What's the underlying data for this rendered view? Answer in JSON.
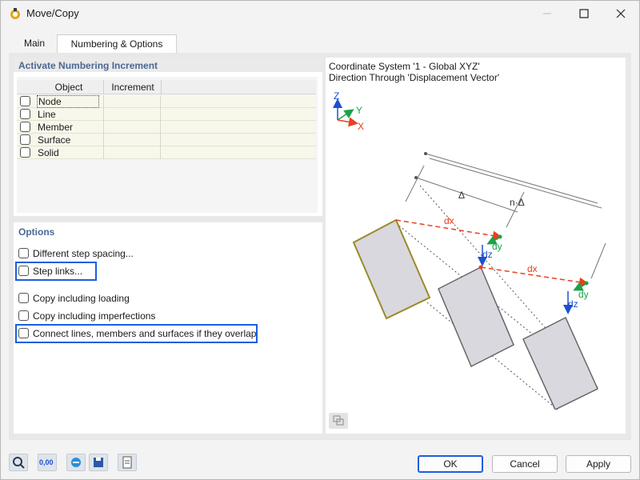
{
  "window": {
    "title": "Move/Copy"
  },
  "tabs": [
    {
      "label": "Main"
    },
    {
      "label": "Numbering & Options"
    }
  ],
  "numbering": {
    "title": "Activate Numbering Increment",
    "columns": [
      "Object",
      "Increment"
    ],
    "rows": [
      {
        "label": "Node"
      },
      {
        "label": "Line"
      },
      {
        "label": "Member"
      },
      {
        "label": "Surface"
      },
      {
        "label": "Solid"
      }
    ]
  },
  "options": {
    "title": "Options",
    "items": [
      {
        "label": "Different step spacing..."
      },
      {
        "label": "Step links..."
      },
      {
        "label": "Copy including loading"
      },
      {
        "label": "Copy including imperfections"
      },
      {
        "label": "Connect lines, members and surfaces if they overlap"
      }
    ]
  },
  "diagram": {
    "line1": "Coordinate System '1 - Global XYZ'",
    "line2": "Direction Through 'Displacement Vector'",
    "axes": {
      "z": "Z",
      "y": "Y",
      "x": "X"
    },
    "delta": "Δ",
    "n_delta": "n·Δ",
    "dx": "dx",
    "dy": "dy",
    "dz": "dz",
    "colors": {
      "x": "#e8401c",
      "y": "#1aa34a",
      "z": "#1d4fcf"
    }
  },
  "buttons": {
    "ok": "OK",
    "cancel": "Cancel",
    "apply": "Apply"
  },
  "toolbar": {
    "icons": [
      "search-icon",
      "units-icon",
      "exchange-icon",
      "save-icon",
      "clipboard-icon"
    ],
    "units_text": "0,00"
  }
}
